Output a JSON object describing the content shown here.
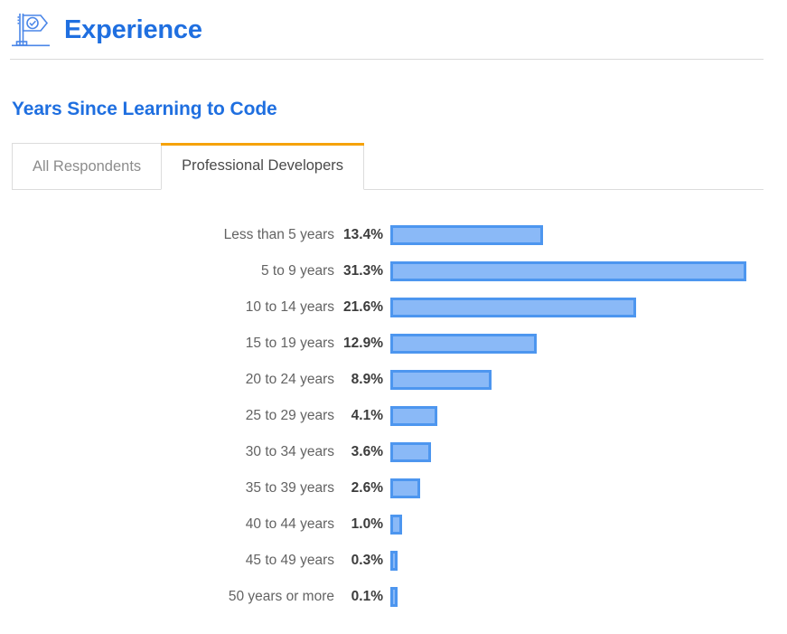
{
  "header": {
    "title": "Experience",
    "icon": "flag-check-icon",
    "title_color": "#1f6fe0"
  },
  "chart_section": {
    "title": "Years Since Learning to Code",
    "tabs": [
      {
        "label": "All Respondents",
        "active": false
      },
      {
        "label": "Professional Developers",
        "active": true
      }
    ],
    "active_tab_accent_color": "#f5a209"
  },
  "chart_data": {
    "type": "bar",
    "orientation": "horizontal",
    "title": "Years Since Learning to Code",
    "subtitle": "Professional Developers",
    "xlabel": "",
    "ylabel": "",
    "xlim": [
      0,
      31.3
    ],
    "grid": false,
    "legend": false,
    "value_suffix": "%",
    "bar_fill_color": "#8ab9f7",
    "bar_border_color": "#4d96ef",
    "categories": [
      "Less than 5 years",
      "5 to 9 years",
      "10 to 14 years",
      "15 to 19 years",
      "20 to 24 years",
      "25 to 29 years",
      "30 to 34 years",
      "35 to 39 years",
      "40 to 44 years",
      "45 to 49 years",
      "50 years or more"
    ],
    "values": [
      13.4,
      31.3,
      21.6,
      12.9,
      8.9,
      4.1,
      3.6,
      2.6,
      1.0,
      0.3,
      0.1
    ],
    "value_labels": [
      "13.4%",
      "31.3%",
      "21.6%",
      "12.9%",
      "8.9%",
      "4.1%",
      "3.6%",
      "2.6%",
      "1.0%",
      "0.3%",
      "0.1%"
    ]
  }
}
